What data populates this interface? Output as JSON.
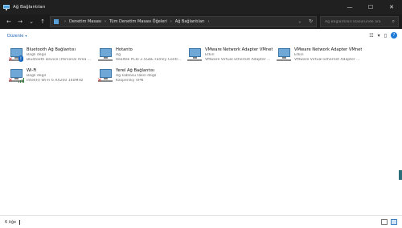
{
  "window": {
    "title": "Ağ Bağlantıları"
  },
  "controls": {
    "minimize": "—",
    "maximize": "☐",
    "close": "✕"
  },
  "nav": {
    "back": "←",
    "forward": "→",
    "down": "⌄",
    "up": "↑"
  },
  "address": {
    "crumbs": [
      "Denetim Masası",
      "Tüm Denetim Masası Öğeleri",
      "Ağ Bağlantıları"
    ],
    "dropdown": "⌄",
    "refresh": "↻"
  },
  "search": {
    "placeholder": "Ağ Bağlantıları klasöründe ara"
  },
  "toolbar": {
    "organize": "Düzenle",
    "organize_caret": "▾",
    "view_caret": "▾",
    "help": "?"
  },
  "items": [
    {
      "name": "Bluetooth Ağ Bağlantısı",
      "status": "Bağlı değil",
      "device": "Bluetooth Device (Personal Area ...",
      "badge": "bluetooth",
      "error": true
    },
    {
      "name": "Hotanto",
      "status": "Ağ",
      "device": "Realtek PCIe 2.5GbE Family Contr...",
      "badge": "none",
      "error": false
    },
    {
      "name": "VMware Network Adapter VMnet1",
      "status": "Etkin",
      "device": "VMware Virtual Ethernet Adapter ...",
      "badge": "none",
      "error": false
    },
    {
      "name": "VMware Network Adapter VMnet8",
      "status": "Etkin",
      "device": "VMware Virtual Ethernet Adapter ...",
      "badge": "none",
      "error": false
    },
    {
      "name": "Wi-Fi",
      "status": "Bağlı değil",
      "device": "Intel(R) Wi-Fi 6 AX200 160MHz",
      "badge": "wifi",
      "error": true
    },
    {
      "name": "Yerel Ağ Bağlantısı",
      "status": "Ağ kablosu takılı değil",
      "device": "Kaspersky VPN",
      "badge": "none",
      "error": true
    }
  ],
  "statusbar": {
    "count": "6 öğe"
  }
}
